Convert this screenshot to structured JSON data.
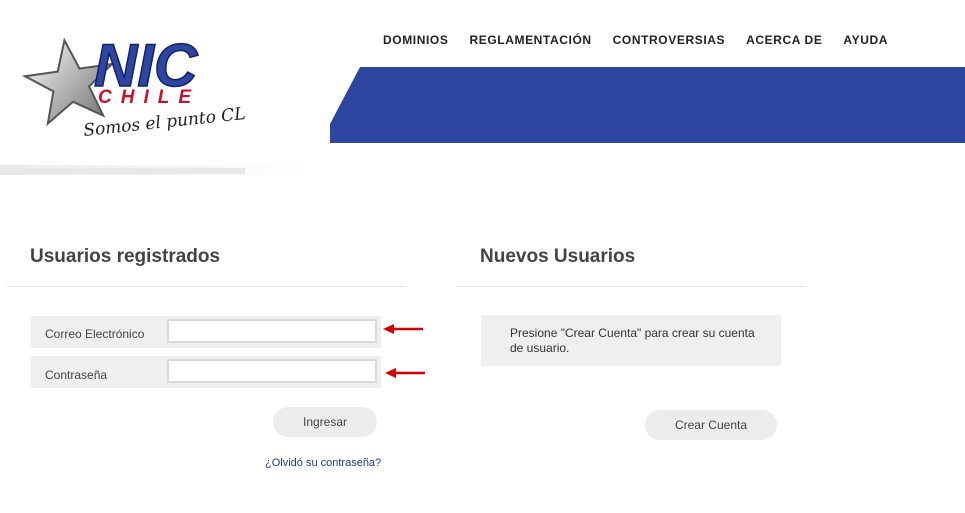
{
  "header": {
    "logo": {
      "brand_top": "NIC",
      "brand_bottom": "CHILE",
      "tagline": "Somos el punto CL"
    },
    "nav": [
      {
        "label": "DOMINIOS"
      },
      {
        "label": "REGLAMENTACIÓN"
      },
      {
        "label": "CONTROVERSIAS"
      },
      {
        "label": "ACERCA DE"
      },
      {
        "label": "AYUDA"
      }
    ],
    "band_color": "#2f46a0"
  },
  "registered": {
    "title": "Usuarios registrados",
    "email_label": "Correo Electrónico",
    "email_value": "",
    "password_label": "Contraseña",
    "password_value": "",
    "submit_label": "Ingresar",
    "forgot_label": "¿Olvidó su contraseña?"
  },
  "new_users": {
    "title": "Nuevos Usuarios",
    "info": "Presione \"Crear Cuenta\" para crear su cuenta de usuario.",
    "create_label": "Crear Cuenta"
  },
  "annotation_color": "#d40000"
}
